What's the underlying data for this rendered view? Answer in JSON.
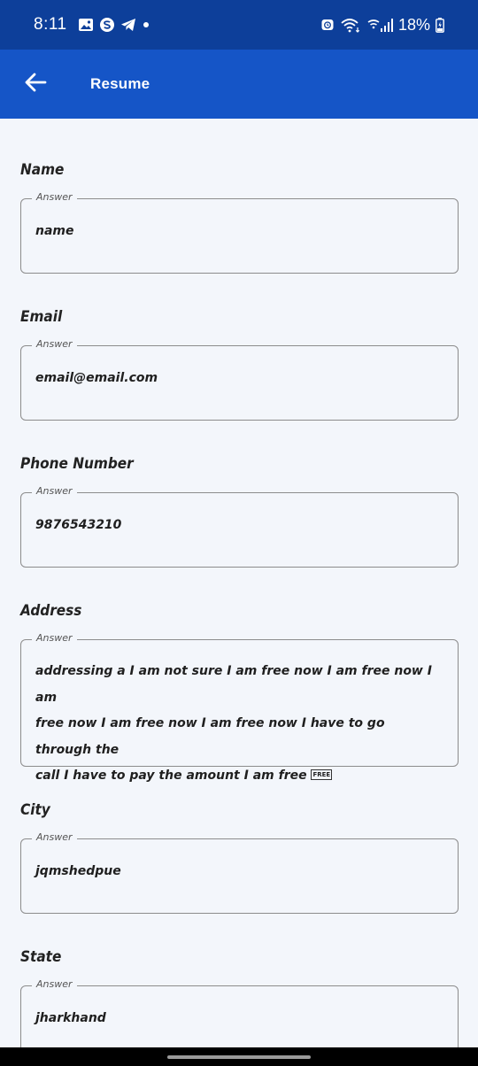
{
  "status_bar": {
    "time": "8:11",
    "battery": "18%",
    "left_icons": [
      "gallery-icon",
      "s-app-icon",
      "telegram-icon",
      "dot-icon"
    ],
    "right_icons": [
      "alarm-icon",
      "wifi-icon",
      "signal-icon",
      "battery-icon"
    ]
  },
  "app_bar": {
    "back_icon": "arrow-left-icon",
    "title": "Resume"
  },
  "fields": [
    {
      "label": "Name",
      "legend": "Answer",
      "value": "name"
    },
    {
      "label": "Email",
      "legend": "Answer",
      "value": "email@email.com"
    },
    {
      "label": "Phone Number",
      "legend": "Answer",
      "value": "9876543210"
    },
    {
      "label": "Address",
      "legend": "Answer",
      "value_lines": [
        "addressing a I am not sure I am free now I am free now I am",
        "free now I am free now I am free now I have to go through the",
        "call I have to pay the amount I am free"
      ],
      "badge": "FREE"
    },
    {
      "label": "City",
      "legend": "Answer",
      "value": "jqmshedpue"
    },
    {
      "label": "State",
      "legend": "Answer",
      "value": "jharkhand"
    }
  ],
  "colors": {
    "status_bar": "#0d3f9a",
    "app_bar": "#1555c7",
    "background": "#f3f6fb",
    "border": "#8c8c8c"
  }
}
